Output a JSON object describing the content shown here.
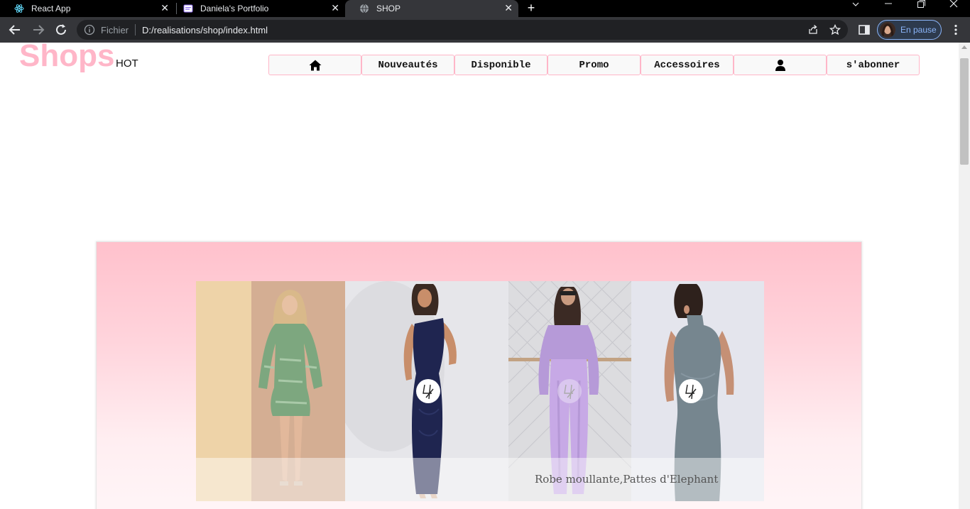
{
  "browser": {
    "tabs": [
      {
        "title": "React App",
        "icon": "react-icon",
        "active": false
      },
      {
        "title": "Daniela's Portfolio",
        "icon": "portfolio-icon",
        "active": false
      },
      {
        "title": "SHOP",
        "icon": "globe-icon",
        "active": true
      }
    ],
    "address": {
      "prefix": "Fichier",
      "url": "D:/realisations/shop/index.html"
    },
    "profile": {
      "label": "En pause"
    }
  },
  "page": {
    "logo": {
      "main": "Shops",
      "sub": "HOT"
    },
    "menu": [
      {
        "label": "",
        "icon": "home-icon"
      },
      {
        "label": "Nouveautés"
      },
      {
        "label": "Disponible"
      },
      {
        "label": "Promo"
      },
      {
        "label": "Accessoires"
      },
      {
        "label": "",
        "icon": "user-icon"
      },
      {
        "label": "s'abonner"
      }
    ],
    "slider": {
      "caption": "Robe moullante,Pattes d'Elephant"
    },
    "colors": {
      "brand_pink": "#ffb6c8",
      "promo_gradient_top": "#ffc1cc"
    }
  }
}
